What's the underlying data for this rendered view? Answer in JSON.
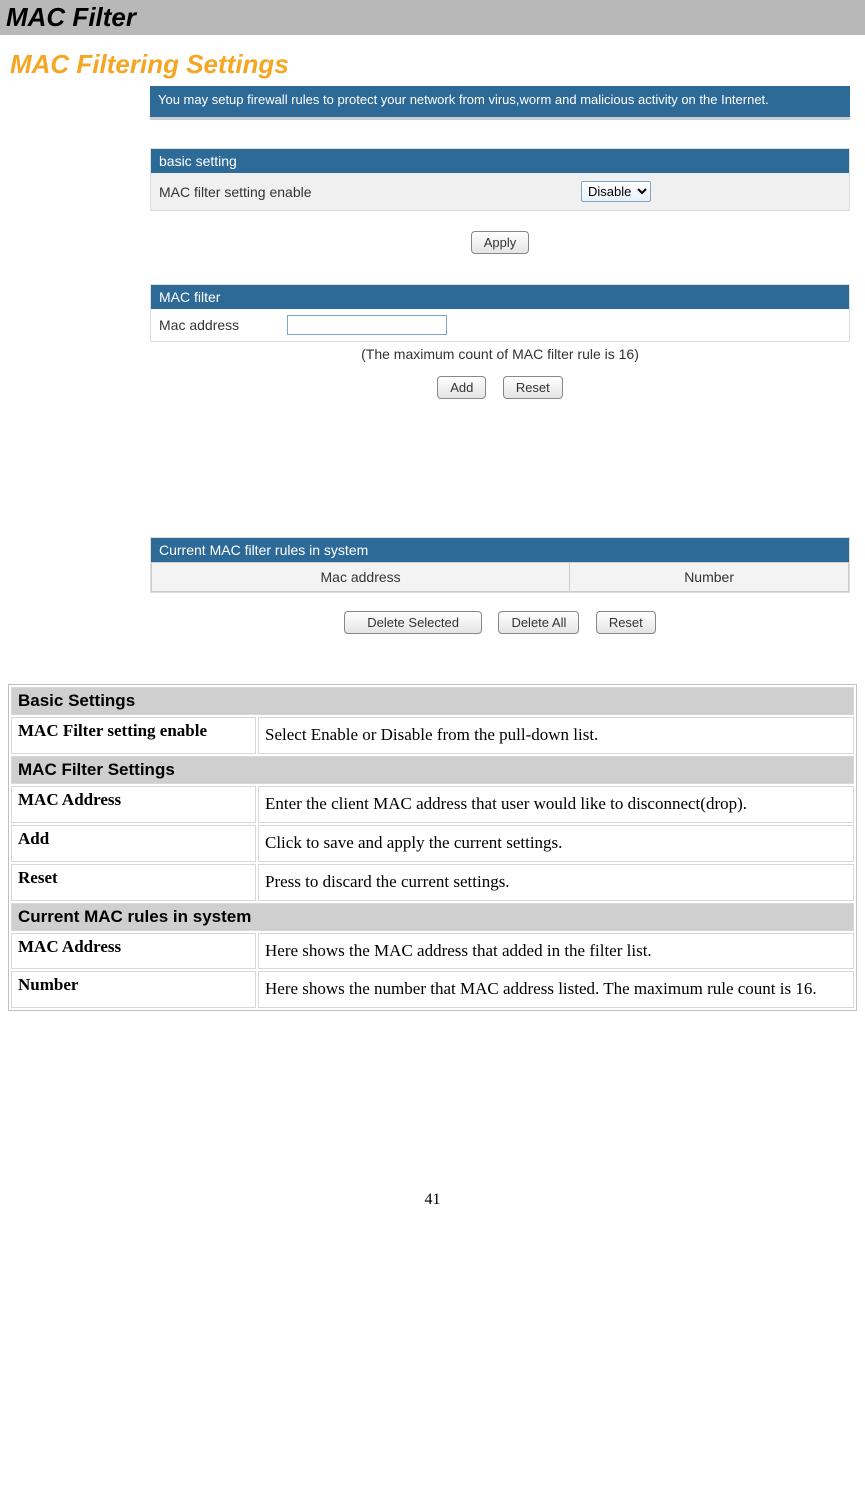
{
  "title_bar": "MAC Filter",
  "settings_heading": "MAC Filtering Settings",
  "intro_text": "You may setup firewall rules to protect your network from virus,worm and malicious activity on the Internet.",
  "basic_setting": {
    "header": "basic setting",
    "row_label": "MAC filter setting enable",
    "select_value": "Disable",
    "apply": "Apply"
  },
  "mac_filter": {
    "header": "MAC filter",
    "row_label": "Mac address",
    "max_note": "(The maximum count of MAC filter rule is 16)",
    "add": "Add",
    "reset": "Reset"
  },
  "rules": {
    "header": "Current MAC filter rules in system",
    "col1": "Mac address",
    "col2": "Number",
    "delete_selected": "Delete Selected",
    "delete_all": "Delete All",
    "reset": "Reset"
  },
  "doc": {
    "section1": "Basic Settings",
    "r1_term": "MAC Filter setting enable",
    "r1_desc": "Select Enable or Disable from the pull-down list.",
    "section2": "MAC Filter Settings",
    "r2_term": "MAC Address",
    "r2_desc": "Enter the client MAC address that user would like to disconnect(drop).",
    "r3_term": "Add",
    "r3_desc": "Click to save and apply the current settings.",
    "r4_term": "Reset",
    "r4_desc": "Press to discard the current settings.",
    "section3": "Current MAC rules in system",
    "r5_term": "MAC Address",
    "r5_desc": "Here shows the MAC address that added in the filter list.",
    "r6_term": "Number",
    "r6_desc": "Here shows the number that MAC address listed. The maximum rule count is 16."
  },
  "page_number": "41"
}
